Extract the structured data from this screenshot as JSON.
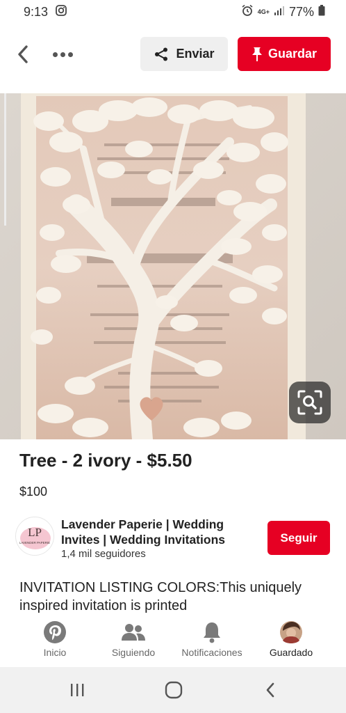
{
  "status_bar": {
    "time": "9:13",
    "network": "4G+",
    "battery": "77%"
  },
  "top_bar": {
    "share_label": "Enviar",
    "save_label": "Guardar"
  },
  "pin": {
    "title": "Tree - 2 ivory - $5.50",
    "price": "$100",
    "description": "INVITATION LISTING COLORS:This uniquely inspired invitation is printed"
  },
  "creator": {
    "avatar_initials": "LP",
    "avatar_caption": "LAVENDER PAPERIE",
    "name": "Lavender Paperie | Wedding Invites | Wedding Invitations",
    "followers": "1,4 mil seguidores",
    "follow_label": "Seguir"
  },
  "bottom_nav": [
    {
      "label": "Inicio"
    },
    {
      "label": "Siguiendo"
    },
    {
      "label": "Notificaciones"
    },
    {
      "label": "Guardado"
    }
  ],
  "colors": {
    "accent": "#e60023",
    "share_bg": "#efefef",
    "text": "#222222"
  }
}
